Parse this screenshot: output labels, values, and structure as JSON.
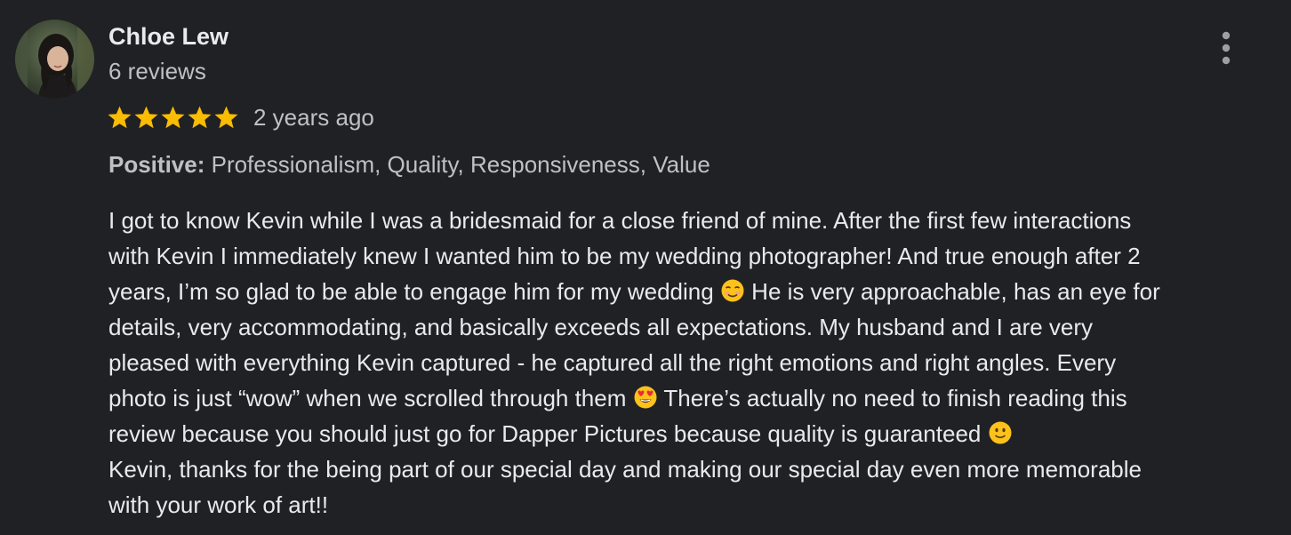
{
  "reviewer": {
    "name": "Chloe Lew",
    "review_count": "6 reviews",
    "avatar_icon": "profile-photo"
  },
  "menu": {
    "icon": "more-vertical-icon"
  },
  "rating": {
    "stars": 5,
    "max_stars": 5,
    "star_color": "#fbbc04",
    "date": "2 years ago"
  },
  "highlights": {
    "label": "Positive:",
    "values": " Professionalism, Quality, Responsiveness, Value"
  },
  "body": {
    "lines": [
      {
        "segments": [
          {
            "text": "I got to know Kevin while I was a bridesmaid for a close friend of mine. After the first few interactions"
          }
        ]
      },
      {
        "segments": [
          {
            "text": "with Kevin I immediately knew I wanted him to be my wedding photographer! And true enough after 2"
          }
        ]
      },
      {
        "segments": [
          {
            "text": "years, I’m so glad to be able to engage him for my wedding "
          },
          {
            "emoji": "smiling-face-icon"
          },
          {
            "text": " He is very approachable, has an eye for"
          }
        ]
      },
      {
        "segments": [
          {
            "text": "details, very accommodating, and basically exceeds all expectations. My husband and I are very"
          }
        ]
      },
      {
        "segments": [
          {
            "text": "pleased with everything Kevin captured - he captured all the right emotions and right angles. Every"
          }
        ]
      },
      {
        "segments": [
          {
            "text": "photo is just “wow” when we scrolled through them "
          },
          {
            "emoji": "heart-eyes-icon"
          },
          {
            "text": "  There’s actually no need to finish reading this"
          }
        ]
      },
      {
        "segments": [
          {
            "text": "review because you should just go for Dapper Pictures because quality is guaranteed "
          },
          {
            "emoji": "slight-smile-icon"
          }
        ]
      },
      {
        "segments": [
          {
            "text": "Kevin, thanks for the being part of our special day and making our special day even more memorable"
          }
        ]
      },
      {
        "segments": [
          {
            "text": "with your work of art!!"
          }
        ]
      }
    ]
  },
  "colors": {
    "background": "#202124",
    "primary_text": "#e8eaed",
    "secondary_text": "#bdc1c6"
  }
}
